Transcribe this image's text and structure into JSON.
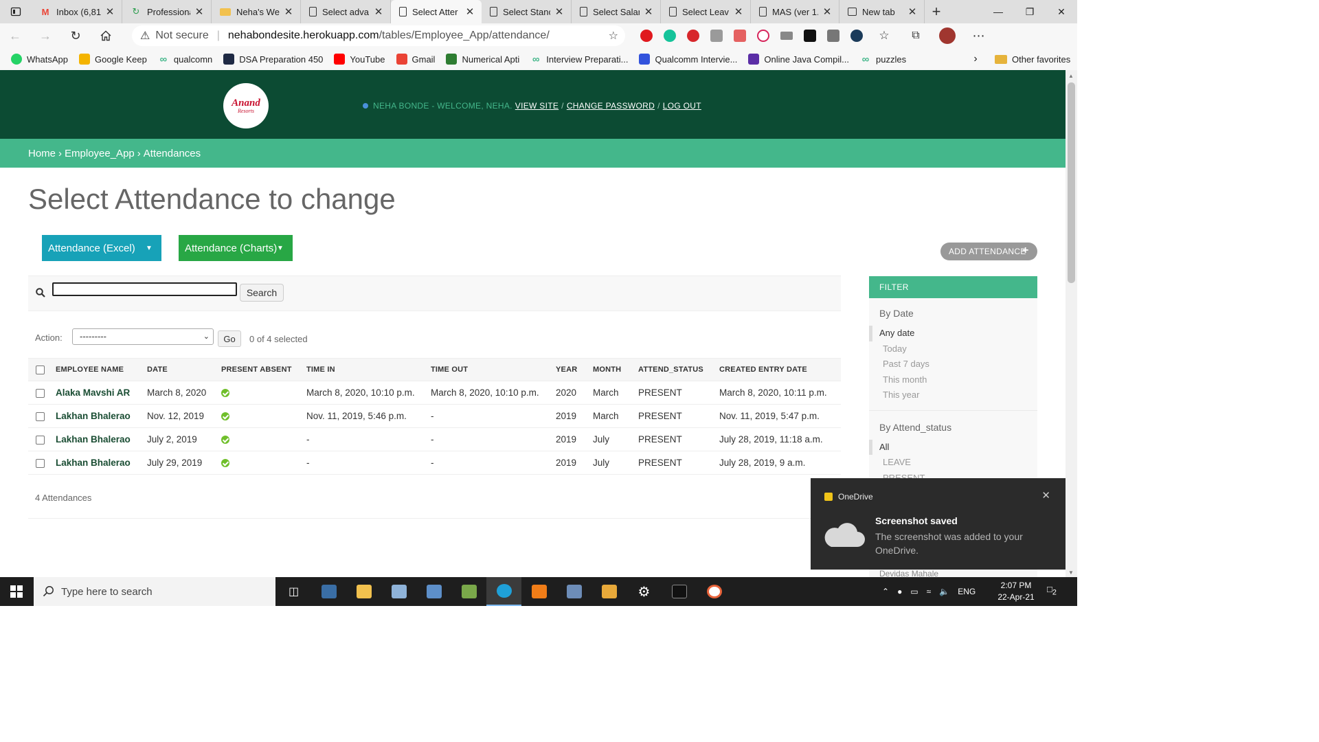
{
  "browser": {
    "tabs": [
      {
        "title": "Inbox (6,81",
        "icon": "gmail-icon",
        "active": false
      },
      {
        "title": "Professiona",
        "icon": "refresh-green-icon",
        "active": false
      },
      {
        "title": "Neha's Web",
        "icon": "folder-icon",
        "active": false
      },
      {
        "title": "Select adva",
        "icon": "page-icon",
        "active": false
      },
      {
        "title": "Select Atter",
        "icon": "page-icon",
        "active": true
      },
      {
        "title": "Select Stanc",
        "icon": "page-icon",
        "active": false
      },
      {
        "title": "Select Salar",
        "icon": "page-icon",
        "active": false
      },
      {
        "title": "Select Leav",
        "icon": "page-icon",
        "active": false
      },
      {
        "title": "MAS (ver 1.",
        "icon": "page-icon",
        "active": false
      },
      {
        "title": "New tab",
        "icon": "newtab-icon",
        "active": false
      }
    ],
    "address": {
      "security": "Not secure",
      "host": "nehabondesite.herokuapp.com",
      "path": "/tables/Employee_App/attendance/"
    },
    "bookmarks": [
      {
        "label": "WhatsApp",
        "icon": "whatsapp-icon",
        "color": "#25d366"
      },
      {
        "label": "Google Keep",
        "icon": "keep-icon",
        "color": "#f4b400"
      },
      {
        "label": "qualcomn",
        "icon": "link-icon",
        "color": "#44b78b"
      },
      {
        "label": "DSA Preparation 450",
        "icon": "react-icon",
        "color": "#1f2a44"
      },
      {
        "label": "YouTube",
        "icon": "youtube-icon",
        "color": "#ff0000"
      },
      {
        "label": "Gmail",
        "icon": "gmail-icon",
        "color": "#ea4335"
      },
      {
        "label": "Numerical Apti",
        "icon": "bird-icon",
        "color": "#2e7d32"
      },
      {
        "label": "Interview Preparati...",
        "icon": "link-icon",
        "color": "#44b78b"
      },
      {
        "label": "Qualcomm Intervie...",
        "icon": "qualcomm-icon",
        "color": "#3253dc"
      },
      {
        "label": "Online Java Compil...",
        "icon": "bolt-icon",
        "color": "#5b2ea6"
      },
      {
        "label": "puzzles",
        "icon": "link-icon",
        "color": "#44b78b"
      }
    ],
    "other_favorites": "Other favorites"
  },
  "header": {
    "logo_line1": "Anand",
    "logo_line2": "Resorts",
    "user_greeting": "NEHA BONDE - WELCOME, NEHA.",
    "view_site": "VIEW SITE",
    "change_password": "CHANGE PASSWORD",
    "log_out": "LOG OUT",
    "separator": "/"
  },
  "breadcrumbs": {
    "home": "Home",
    "app": "Employee_App",
    "current": "Attendances",
    "sep": "›"
  },
  "page_title": "Select Attendance to change",
  "buttons": {
    "excel": "Attendance (Excel)",
    "charts": "Attendance (Charts)",
    "add": "ADD ATTENDANCE"
  },
  "search": {
    "value": "",
    "button": "Search"
  },
  "actions": {
    "label": "Action:",
    "selected_option": "---------",
    "go": "Go",
    "count": "0 of 4 selected"
  },
  "table": {
    "columns": [
      "EMPLOYEE NAME",
      "DATE",
      "PRESENT ABSENT",
      "TIME IN",
      "TIME OUT",
      "YEAR",
      "MONTH",
      "ATTEND_STATUS",
      "CREATED ENTRY DATE"
    ],
    "rows": [
      {
        "name": "Alaka Mavshi AR",
        "date": "March 8, 2020",
        "time_in": "March 8, 2020, 10:10 p.m.",
        "time_out": "March 8, 2020, 10:10 p.m.",
        "year": "2020",
        "month": "March",
        "status": "PRESENT",
        "created": "March 8, 2020, 10:11 p.m."
      },
      {
        "name": "Lakhan Bhalerao",
        "date": "Nov. 12, 2019",
        "time_in": "Nov. 11, 2019, 5:46 p.m.",
        "time_out": "-",
        "year": "2019",
        "month": "March",
        "status": "PRESENT",
        "created": "Nov. 11, 2019, 5:47 p.m."
      },
      {
        "name": "Lakhan Bhalerao",
        "date": "July 2, 2019",
        "time_in": "-",
        "time_out": "-",
        "year": "2019",
        "month": "July",
        "status": "PRESENT",
        "created": "July 28, 2019, 11:18 a.m."
      },
      {
        "name": "Lakhan Bhalerao",
        "date": "July 29, 2019",
        "time_in": "-",
        "time_out": "-",
        "year": "2019",
        "month": "July",
        "status": "PRESENT",
        "created": "July 28, 2019, 9 a.m."
      }
    ]
  },
  "paginator": "4 Attendances",
  "filter": {
    "title": "FILTER",
    "by_date": {
      "heading": "By Date",
      "options": [
        "Any date",
        "Today",
        "Past 7 days",
        "This month",
        "This year"
      ]
    },
    "by_status": {
      "heading": "By Attend_status",
      "options": [
        "All",
        "LEAVE",
        "PRESENT"
      ]
    },
    "hidden_text": "Devidas Mahale"
  },
  "toast": {
    "app": "OneDrive",
    "title": "Screenshot saved",
    "body": "The screenshot was added to your OneDrive."
  },
  "taskbar": {
    "search_placeholder": "Type here to search",
    "lang": "ENG",
    "time": "2:07 PM",
    "date": "22-Apr-21",
    "notifications": "2"
  },
  "colors": {
    "django_dark": "#0c4b33",
    "django_green": "#44b78b",
    "excel_btn": "#17a2b8",
    "charts_btn": "#28a745"
  }
}
